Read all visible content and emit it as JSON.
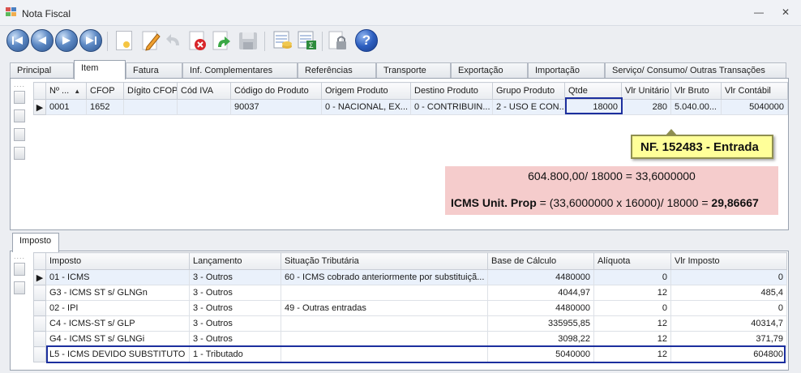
{
  "window": {
    "title": "Nota Fiscal",
    "minimize": "—",
    "close": "✕"
  },
  "toolbar": {
    "icons": [
      "first-record-icon",
      "previous-record-icon",
      "next-record-icon",
      "last-record-icon",
      "new-document-icon",
      "edit-icon",
      "undo-icon",
      "delete-icon",
      "redo-icon",
      "save-icon",
      "database-icon",
      "spreadsheet-icon",
      "lock-icon",
      "help-icon"
    ],
    "help_label": "?"
  },
  "main_tabs": [
    "Principal",
    "Item",
    "Fatura",
    "Inf. Complementares",
    "Referências",
    "Transporte",
    "Exportação",
    "Importação",
    "Serviço/ Consumo/ Outras Transações"
  ],
  "item_grid": {
    "grip": "....",
    "columns": [
      "Nº ...",
      "CFOP",
      "Dígito CFOP",
      "Cód IVA",
      "Código do Produto",
      "Origem Produto",
      "Destino Produto",
      "Grupo Produto",
      "Qtde",
      "Vlr Unitário",
      "Vlr Bruto",
      "Vlr Contábil"
    ],
    "sort_indicator": "▲",
    "row_marker": "▶",
    "rows": [
      [
        "0001",
        "1652",
        "",
        "",
        "90037",
        "0 - NACIONAL, EX...",
        "0 - CONTRIBUIN...",
        "2 - USO E CON...",
        "18000",
        "280",
        "5.040.00...",
        "5040000"
      ]
    ]
  },
  "callout": {
    "text": "NF. 152483 - Entrada"
  },
  "calc": {
    "line1": "604.800,00/ 18000 = 33,6000000",
    "line2_label": "ICMS Unit. Prop",
    "line2_expr": " = (33,6000000 x 16000)/ 18000 = ",
    "line2_result": "29,86667"
  },
  "bottom_tabs": [
    "Imposto"
  ],
  "tax_grid": {
    "grip": "....",
    "columns": [
      "Imposto",
      "Lançamento",
      "Situação Tributária",
      "Base de Cálculo",
      "Alíquota",
      "Vlr Imposto"
    ],
    "row_marker": "▶",
    "rows": [
      [
        "01 - ICMS",
        "3 - Outros",
        "60 - ICMS cobrado anteriormente por substituiçã...",
        "4480000",
        "0",
        "0"
      ],
      [
        "G3 - ICMS ST s/ GLNGn",
        "3 - Outros",
        "",
        "4044,97",
        "12",
        "485,4"
      ],
      [
        "02 - IPI",
        "3 - Outros",
        "49 - Outras entradas",
        "4480000",
        "0",
        "0"
      ],
      [
        "C4 - ICMS-ST s/ GLP",
        "3 - Outros",
        "",
        "335955,85",
        "12",
        "40314,7"
      ],
      [
        "G4 - ICMS ST s/ GLNGi",
        "3 - Outros",
        "",
        "3098,22",
        "12",
        "371,79"
      ],
      [
        "L5 - ICMS DEVIDO SUBSTITUTO",
        "1 - Tributado",
        "",
        "5040000",
        "12",
        "604800"
      ]
    ]
  },
  "colors": {
    "highlight_border": "#1c2f9e",
    "callout_bg": "#ffff99",
    "calc_bg": "#f5cccc"
  }
}
